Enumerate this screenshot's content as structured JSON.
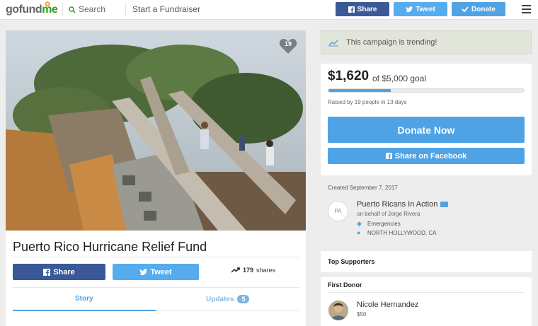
{
  "header": {
    "logo_go": "go",
    "logo_fund": "fund",
    "logo_me": "me",
    "search_label": "Search",
    "start_label": "Start a Fundraiser",
    "share_label": "Share",
    "tweet_label": "Tweet",
    "donate_label": "Donate"
  },
  "photo": {
    "heart_count": "19"
  },
  "campaign": {
    "title": "Puerto Rico Hurricane Relief Fund",
    "share_label": "Share",
    "tweet_label": "Tweet",
    "shares_count": "179",
    "shares_label": "shares"
  },
  "tabs": {
    "story": "Story",
    "updates": "Updates",
    "updates_count": "5"
  },
  "trending": {
    "text": "This campaign is trending!"
  },
  "funding": {
    "raised": "$1,620",
    "goal_text": "of $5,000 goal",
    "progress_percent": 32,
    "raised_by": "Raised by 19 people in 13 days",
    "donate_now": "Donate Now",
    "share_facebook": "Share on Facebook"
  },
  "organizer": {
    "created": "Created September 7, 2017",
    "initials": "PA",
    "name": "Puerto Ricans In Action",
    "on_behalf": "on behalf of Jorge Rivera",
    "category": "Emergencies",
    "location": "NORTH HOLLYWOOD, CA"
  },
  "supporters": {
    "top_title": "Top Supporters",
    "first_donor_title": "First Donor",
    "donor_name": "Nicole Hernandez",
    "donor_amount": "$50"
  },
  "colors": {
    "accent": "#4fa3e5",
    "facebook": "#3b5998",
    "twitter": "#55acee",
    "brand_green": "#2ca21f"
  }
}
